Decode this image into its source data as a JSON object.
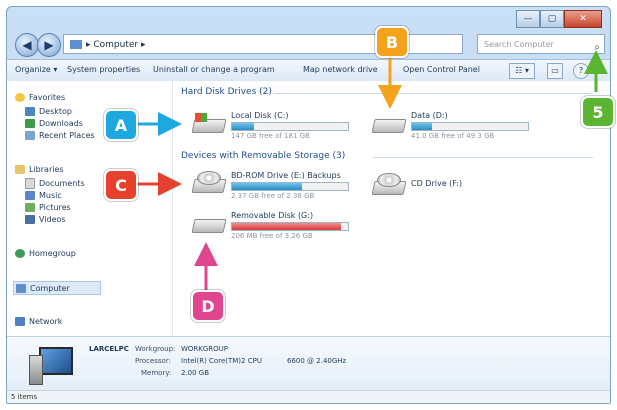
{
  "window": {
    "controls": [
      "—",
      "▢",
      "✕"
    ]
  },
  "nav": {
    "back": "◀",
    "forward": "▶",
    "address": "▸ Computer ▸",
    "search_placeholder": "Search Computer",
    "search_icon": "⌕"
  },
  "toolbar": {
    "organize": "Organize ▾",
    "system_properties": "System properties",
    "uninstall": "Uninstall or change a program",
    "map_drive": "Map network drive",
    "control_panel": "Open Control Panel",
    "view_icon": "☷ ▾",
    "preview_icon": "▭",
    "help_icon": "?"
  },
  "sidebar": {
    "favorites": "Favorites",
    "desktop": "Desktop",
    "downloads": "Downloads",
    "recent": "Recent Places",
    "libraries": "Libraries",
    "documents": "Documents",
    "music": "Music",
    "pictures": "Pictures",
    "videos": "Videos",
    "homegroup": "Homegroup",
    "computer": "Computer",
    "network": "Network"
  },
  "main": {
    "hdd_header": "Hard Disk Drives (2)",
    "removable_header": "Devices with Removable Storage (3)",
    "drives": [
      {
        "name": "Local Disk (C:)",
        "info": "147 GB free of 181 GB",
        "used_fraction": 0.19
      },
      {
        "name": "Data (D:)",
        "info": "41.0 GB free of 49.3 GB",
        "used_fraction": 0.17
      },
      {
        "name": "BD-ROM Drive (E:) Backups",
        "info": "2.37 GB free of 2.38 GB",
        "used_fraction": 0.6
      },
      {
        "name": "CD Drive (F:)",
        "info": ""
      },
      {
        "name": "Removable Disk (G:)",
        "info": "206 MB free of 3.26 GB",
        "used_fraction": 0.94
      }
    ]
  },
  "details": {
    "computer_name": "LARCELPC",
    "workgroup_label": "Workgroup:",
    "workgroup": "WORKGROUP",
    "processor_label": "Processor:",
    "processor": "Intel(R) Core(TM)2 CPU",
    "processor_speed": "6600 @ 2.40GHz",
    "memory_label": "Memory:",
    "memory": "2.00 GB"
  },
  "status": {
    "items": "5 items"
  },
  "callouts": {
    "a": "A",
    "b": "B",
    "c": "C",
    "d": "D",
    "five": "5"
  },
  "colors": {
    "a": "#1ea8e0",
    "b": "#f4a21c",
    "c": "#e5412d",
    "d": "#e0458f",
    "five": "#5cb531",
    "accent": "#1e4e8c"
  }
}
